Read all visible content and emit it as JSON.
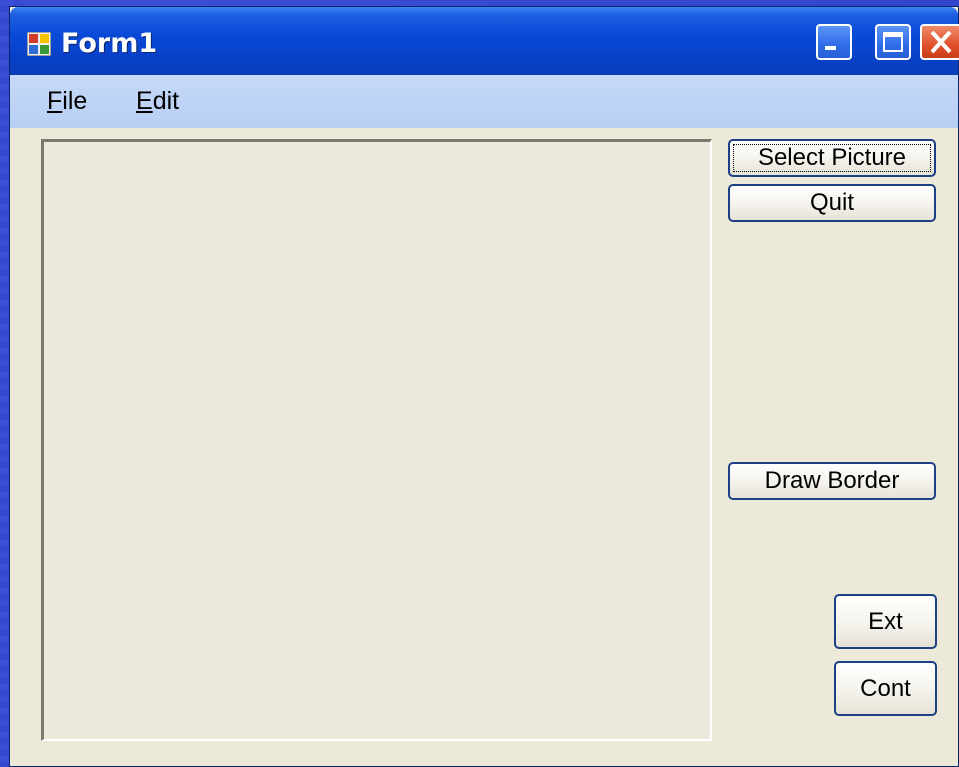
{
  "window": {
    "title": "Form1",
    "controls": {
      "minimize_icon": "minimize-icon",
      "maximize_icon": "maximize-icon",
      "close_icon": "close-icon"
    }
  },
  "menubar": {
    "items": [
      {
        "label_accel": "F",
        "label_rest": "ile"
      },
      {
        "label_accel": "E",
        "label_rest": "dit"
      }
    ]
  },
  "buttons": {
    "select_picture": "Select Picture",
    "quit": "Quit",
    "draw_border": "Draw Border",
    "ext": "Ext",
    "cont": "Cont"
  },
  "colors": {
    "titlebar": "#0a4ad8",
    "window_bg": "#ece9d8",
    "menubar": "#c5d9f8",
    "button_border": "#1c3f86"
  }
}
